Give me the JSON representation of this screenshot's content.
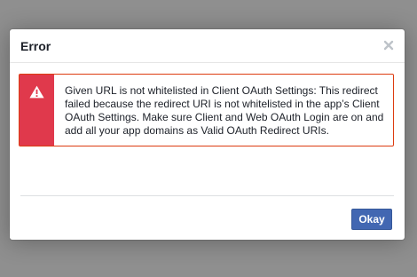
{
  "dialog": {
    "title": "Error",
    "close_icon": "close-icon",
    "alert": {
      "icon": "warning-icon",
      "message": "Given URL is not whitelisted in Client OAuth Settings: This redirect failed because the redirect URI is not whitelisted in the app’s Client OAuth Settings. Make sure Client and Web OAuth Login are on and add all your app domains as Valid OAuth Redirect URIs."
    },
    "okay_label": "Okay"
  },
  "colors": {
    "overlay": "#8f8f8f",
    "alert_red": "#e0394c",
    "button_blue": "#4267b2"
  }
}
